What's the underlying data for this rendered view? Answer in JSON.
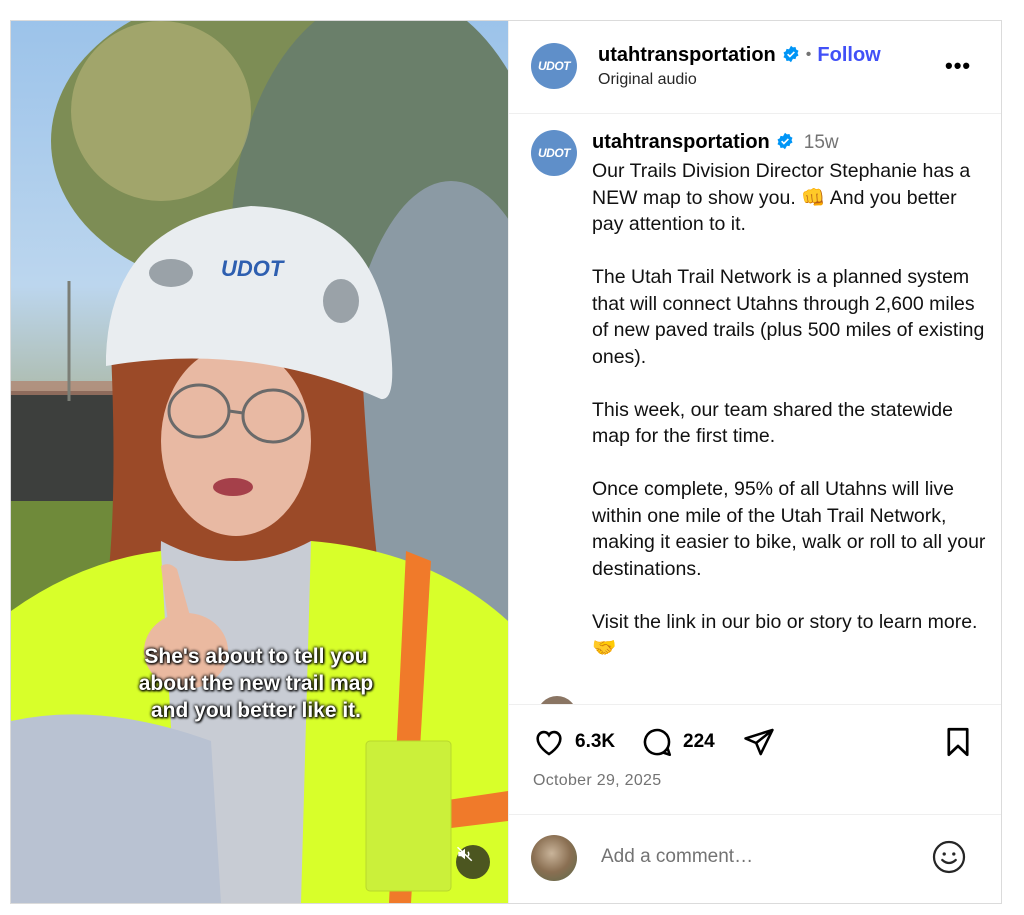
{
  "account": {
    "username": "utahtransportation",
    "logo_text": "UDOT",
    "verified": true,
    "follow_label": "Follow",
    "audio_label": "Original audio"
  },
  "media": {
    "caption_lines": [
      "She's about to tell you",
      "about the new trail map",
      "and you better like it."
    ],
    "helmet_text": "UDOT",
    "muted": true
  },
  "post": {
    "time_ago": "15w",
    "paragraphs": [
      "Our Trails Division Director Stephanie has a NEW map to show you. 👊 And you better pay attention to it.",
      "The Utah Trail Network is a planned system that will connect Utahns through 2,600 miles of new paved trails (plus 500 miles of existing ones).",
      "This week, our team shared the statewide map for the first time.",
      "Once complete, 95% of all Utahns will live within one mile of the Utah Trail Network, making it easier to bike, walk or roll to all your destinations.",
      "Visit the link in our bio or story to learn more. 🤝"
    ]
  },
  "stats": {
    "likes": "6.3K",
    "comments": "224",
    "date": "October 29, 2025"
  },
  "comment_box": {
    "placeholder": "Add a comment…"
  },
  "icons": [
    "heart-icon",
    "comment-icon",
    "share-icon",
    "bookmark-icon",
    "emoji-icon",
    "mute-icon",
    "more-icon",
    "verified-icon"
  ]
}
